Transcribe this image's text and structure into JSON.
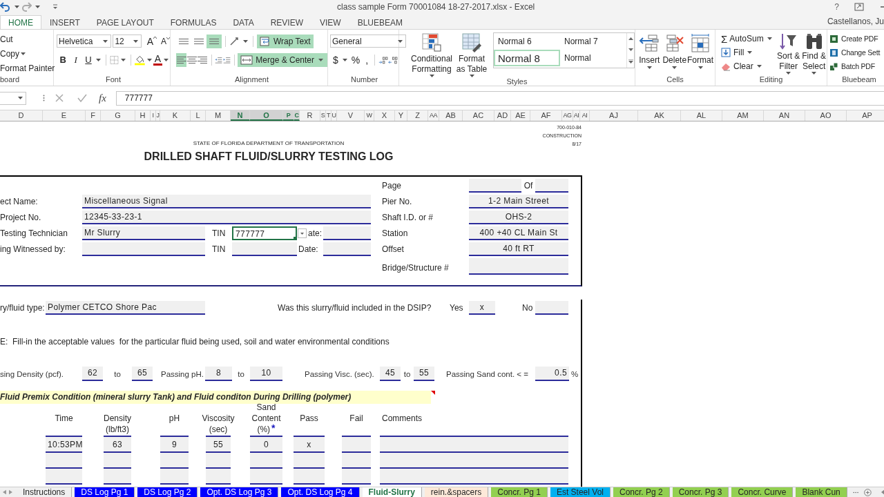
{
  "window": {
    "title": "class sample Form 70001084 18-27-2017.xlsx - Excel",
    "help": "?",
    "user": "Castellanos, Ju"
  },
  "ribbon_tabs": [
    {
      "label": "HOME",
      "selected": true
    },
    {
      "label": "INSERT",
      "selected": false
    },
    {
      "label": "PAGE LAYOUT",
      "selected": false
    },
    {
      "label": "FORMULAS",
      "selected": false
    },
    {
      "label": "DATA",
      "selected": false
    },
    {
      "label": "REVIEW",
      "selected": false
    },
    {
      "label": "VIEW",
      "selected": false
    },
    {
      "label": "BLUEBEAM",
      "selected": false
    }
  ],
  "clipboard": {
    "items": [
      "Cut",
      "Copy",
      "Format Painter"
    ],
    "label": "board"
  },
  "font": {
    "name": "Helvetica",
    "size": "12",
    "size_buttons": [
      "A",
      "A"
    ],
    "style_buttons": [
      "B",
      "I",
      "U"
    ],
    "color_button": "A",
    "label": "Font"
  },
  "alignment": {
    "buttons": [
      {
        "kind": "top",
        "on": false
      },
      {
        "kind": "middle",
        "on": false
      },
      {
        "kind": "bottom",
        "on": true
      },
      {
        "kind": "left",
        "on": true
      },
      {
        "kind": "center",
        "on": false
      },
      {
        "kind": "right",
        "on": false
      }
    ],
    "wrap_text": {
      "label": "Wrap Text",
      "on": true
    },
    "merge_center": {
      "label": "Merge & Center",
      "on": true
    },
    "label": "Alignment"
  },
  "number": {
    "format": "General",
    "symbols": [
      "$",
      "%",
      ","
    ],
    "label": "Number"
  },
  "styles": {
    "commands": [
      "Conditional Formatting",
      "Format as Table"
    ],
    "gallery": [
      {
        "label": "Normal 6",
        "selected": false
      },
      {
        "label": "Normal 7",
        "selected": false
      },
      {
        "label": "Normal 8",
        "selected": true
      },
      {
        "label": "Normal",
        "selected": false
      }
    ],
    "label": "Styles"
  },
  "cells": {
    "commands": [
      "Insert",
      "Delete",
      "Format"
    ],
    "label": "Cells"
  },
  "editing": {
    "sum_symbol": "Σ",
    "items": [
      "AutoSum",
      "Fill",
      "Clear"
    ],
    "commands": [
      "Sort & Filter",
      "Find & Select"
    ],
    "label": "Editing"
  },
  "bluebeam": {
    "items": [
      "Create PDF",
      "Change Sett",
      "Batch PDF"
    ],
    "label": "Bluebeam"
  },
  "formula_bar": {
    "function_label": "fx",
    "value": "777777"
  },
  "columns": [
    {
      "label": "D",
      "selected": false
    },
    {
      "label": "E",
      "selected": false
    },
    {
      "label": "F",
      "selected": false
    },
    {
      "label": "G",
      "selected": false
    },
    {
      "label": "H",
      "selected": false
    },
    {
      "label": "I",
      "selected": false
    },
    {
      "label": "J",
      "selected": false
    },
    {
      "label": "K",
      "selected": false
    },
    {
      "label": "L",
      "selected": false
    },
    {
      "label": "M",
      "selected": false
    },
    {
      "label": "N",
      "selected": true
    },
    {
      "label": "O",
      "selected": true
    },
    {
      "label": "P",
      "selected": true
    },
    {
      "label": "C",
      "selected": true
    },
    {
      "label": "R",
      "selected": false
    },
    {
      "label": "S",
      "selected": false
    },
    {
      "label": "T",
      "selected": false
    },
    {
      "label": "U",
      "selected": false
    },
    {
      "label": "V",
      "selected": false
    },
    {
      "label": "W",
      "selected": false
    },
    {
      "label": "X",
      "selected": false
    },
    {
      "label": "Y",
      "selected": false
    },
    {
      "label": "Z",
      "selected": false
    },
    {
      "label": "AA",
      "selected": false
    },
    {
      "label": "AB",
      "selected": false
    },
    {
      "label": "AC",
      "selected": false
    },
    {
      "label": "AD",
      "selected": false
    },
    {
      "label": "AE",
      "selected": false
    },
    {
      "label": "AF",
      "selected": false
    },
    {
      "label": "AG",
      "selected": false
    },
    {
      "label": "AI",
      "selected": false
    },
    {
      "label": "AI",
      "selected": false
    },
    {
      "label": "AJ",
      "selected": false
    },
    {
      "label": "AK",
      "selected": false
    },
    {
      "label": "AL",
      "selected": false
    },
    {
      "label": "AM",
      "selected": false
    },
    {
      "label": "AN",
      "selected": false
    },
    {
      "label": "AO",
      "selected": false
    },
    {
      "label": "AP",
      "selected": false
    }
  ],
  "form": {
    "code": [
      "700-010-84",
      "CONSTRUCTION",
      "8/17"
    ],
    "agency": "STATE OF FLORIDA DEPARTMENT OF TRANSPORTATION",
    "title": "DRILLED SHAFT FLUID/SLURRY TESTING LOG",
    "page": {
      "label": "Page",
      "of": "Of"
    },
    "left_fields": [
      {
        "label": "ect Name:",
        "value": "Miscellaneous Signal"
      },
      {
        "label": "Project No.",
        "value": "12345-33-23-1"
      }
    ],
    "technician": {
      "label": "Testing Technician",
      "value": "Mr Slurry",
      "tin_label": "TIN",
      "tin": {
        "value": "777777",
        "selected": true
      },
      "date_label": "ate:"
    },
    "witness": {
      "label": "ing Witnessed by:",
      "tin_label": "TIN",
      "tin": {
        "selected": false
      },
      "date_label": "Date:"
    },
    "right_fields": [
      {
        "label": "Pier No.",
        "value": "1-2 Main Street"
      },
      {
        "label": "Shaft I.D. or #",
        "value": "OHS-2"
      },
      {
        "label": "Station",
        "value": "400 +40 CL Main St"
      },
      {
        "label": "Offset",
        "value": "40 ft RT"
      },
      {
        "label": "Bridge/Structure #"
      }
    ],
    "fluid_type": {
      "label": "ry/fluid type:",
      "value": "Polymer CETCO Shore Pac"
    },
    "dsip": {
      "question": "Was this slurry/fluid included in the DSIP?",
      "yes_label": "Yes",
      "yes": "x",
      "no_label": "No"
    },
    "note": "E:  Fill-in the acceptable values  for the particular fluid being used, soil and water environmental conditions",
    "limits": [
      {
        "label": "sing Density (pcf).",
        "from": "62",
        "to_label": "to",
        "to": "65"
      },
      {
        "label": "Passing pH.",
        "from": "8",
        "to_label": "to",
        "to": "10"
      },
      {
        "label": "Passing Visc. (sec).",
        "from": "45",
        "to_label": "to",
        "to": "55"
      }
    ],
    "sand_limit": {
      "label": "Passing Sand cont. < =",
      "value": "0.5",
      "unit": "%"
    },
    "section_title": "Fluid Premix Condition (mineral slurry Tank) and Fluid conditon During Drilling (polymer)",
    "table": {
      "columns": [
        {
          "label": "Time"
        },
        {
          "label": "Density",
          "unit": "(lb/ft3)"
        },
        {
          "label": "pH"
        },
        {
          "label": "Viscosity",
          "unit": "(sec)"
        },
        {
          "label": "Sand Content",
          "unit": "(%)",
          "note": "*"
        },
        {
          "label": "Pass"
        },
        {
          "label": "Fail"
        },
        {
          "label": "Comments"
        }
      ],
      "rows": [
        {
          "values": [
            "10:53PM",
            "63",
            "9",
            "55",
            "0",
            "x"
          ]
        },
        {},
        {}
      ]
    }
  },
  "sheet_tabs": [
    {
      "label": "Instructions",
      "selected": false
    },
    {
      "label": "DS Log Pg 1",
      "selected": false,
      "color": "#0000ff"
    },
    {
      "label": "DS Log Pg 2",
      "selected": false,
      "color": "#0000ff"
    },
    {
      "label": "Opt. DS Log Pg 3",
      "selected": false,
      "color": "#0000ff"
    },
    {
      "label": "Opt. DS Log Pg 4",
      "selected": false,
      "color": "#0000ff"
    },
    {
      "label": "Fluid-Slurry",
      "selected": true
    },
    {
      "label": "rein.&spacers",
      "selected": false,
      "color": "#fde9d9"
    },
    {
      "label": "Concr. Pg 1",
      "selected": false,
      "color": "#92d050"
    },
    {
      "label": "Est Steel Vol",
      "selected": false,
      "color": "#00b0f0"
    },
    {
      "label": "Concr. Pg 2",
      "selected": false,
      "color": "#92d050"
    },
    {
      "label": "Concr. Pg 3",
      "selected": false,
      "color": "#92d050"
    },
    {
      "label": "Concr. Curve",
      "selected": false,
      "color": "#92d050"
    },
    {
      "label": "Blank Cun",
      "selected": false,
      "color": "#92d050"
    }
  ]
}
